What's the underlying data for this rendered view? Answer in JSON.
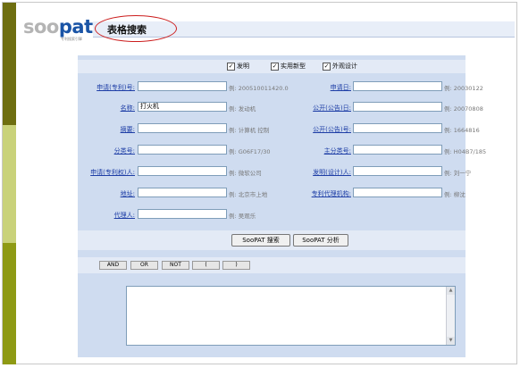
{
  "logo": {
    "part1": "soo",
    "part2": "pat",
    "subtitle": "专利搜索引擎"
  },
  "page_title": "表格搜索",
  "checkboxes": [
    {
      "label": "发明",
      "checked": true
    },
    {
      "label": "实用新型",
      "checked": true
    },
    {
      "label": "外观设计",
      "checked": true
    }
  ],
  "fields": {
    "application_no": {
      "label": "申请(专利)号:",
      "value": "",
      "example": "例: 200510011420.0"
    },
    "application_date": {
      "label": "申请日:",
      "value": "",
      "example": "例: 20030122"
    },
    "name": {
      "label": "名称:",
      "value": "打火机",
      "example": "例: 发动机"
    },
    "publication_date": {
      "label": "公开(公告)日:",
      "value": "",
      "example": "例: 20070808"
    },
    "abstract": {
      "label": "摘要:",
      "value": "",
      "example": "例: 计算机 控制"
    },
    "publication_no": {
      "label": "公开(公告)号:",
      "value": "",
      "example": "例: 1664816"
    },
    "classification": {
      "label": "分类号:",
      "value": "",
      "example": "例: G06F17/30"
    },
    "main_classification": {
      "label": "主分类号:",
      "value": "",
      "example": "例: H04B7/185"
    },
    "applicant": {
      "label": "申请(专利权)人:",
      "value": "",
      "example": "例: 微软公司"
    },
    "inventor": {
      "label": "发明(设计)人:",
      "value": "",
      "example": "例: 刘一宁"
    },
    "address": {
      "label": "地址:",
      "value": "",
      "example": "例: 北京市上地"
    },
    "agency": {
      "label": "专利代理机构:",
      "value": "",
      "example": "例: 柳沈"
    },
    "agent": {
      "label": "代理人:",
      "value": "",
      "example": "例: 吴观乐"
    }
  },
  "buttons": {
    "search": "SooPAT 搜索",
    "analysis": "SooPAT 分析"
  },
  "operators": [
    "AND",
    "OR",
    "NOT",
    "(",
    ")"
  ],
  "scrollbar": {
    "up": "▲",
    "down": "▼"
  }
}
